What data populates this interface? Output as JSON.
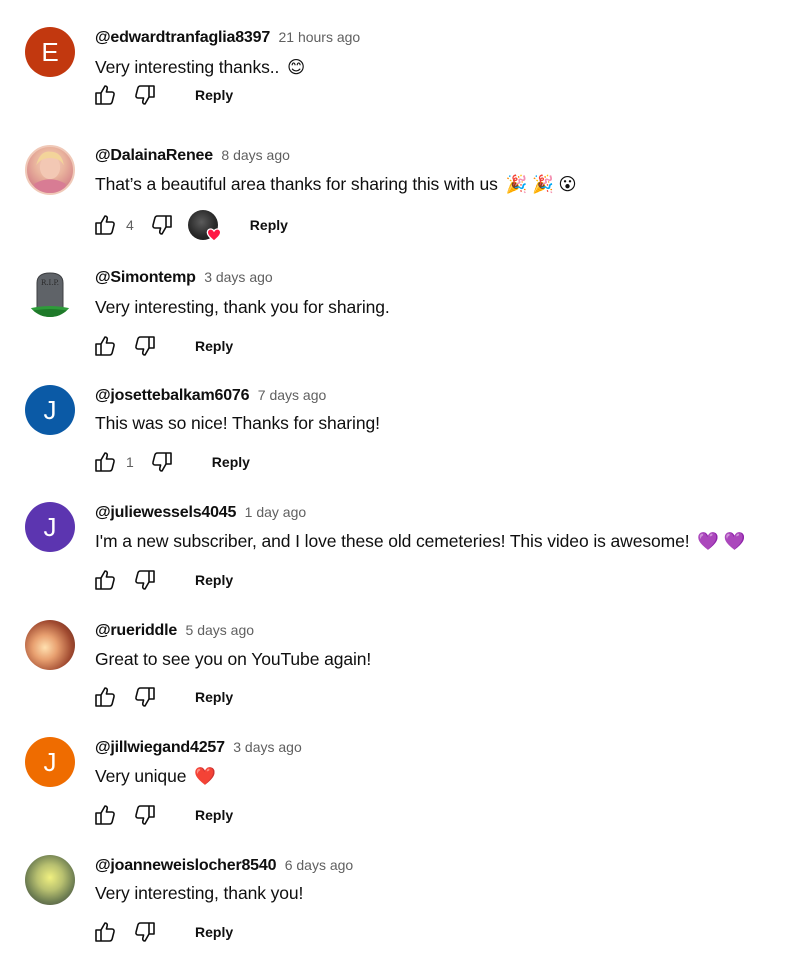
{
  "comments": [
    {
      "avatar_letter": "E",
      "avatar_color": "#c2380f",
      "handle": "@edwardtranfaglia8397",
      "time": "21 hours ago",
      "text": "Very interesting thanks..",
      "emoji": "😊",
      "likes": "",
      "reply": "Reply",
      "creator_heart": false
    },
    {
      "avatar_letter": "",
      "avatar_color": "#e8b4a8",
      "handle": "@DalainaRenee",
      "time": "8 days ago",
      "text": "That’s a beautiful area thanks for sharing this with us",
      "emoji": "🎉 🎉 😮",
      "likes": "4",
      "reply": "Reply",
      "creator_heart": true
    },
    {
      "avatar_letter": "",
      "avatar_color": "#ffffff",
      "handle": "@Simontemp",
      "time": "3 days ago",
      "text": "Very interesting, thank you for sharing.",
      "emoji": "",
      "likes": "",
      "reply": "Reply",
      "creator_heart": false,
      "avatar_tombstone": "R.I.P."
    },
    {
      "avatar_letter": "J",
      "avatar_color": "#0b5aa6",
      "handle": "@josettebalkam6076",
      "time": "7 days ago",
      "text": "This was so nice! Thanks for sharing!",
      "emoji": "",
      "likes": "1",
      "reply": "Reply",
      "creator_heart": false
    },
    {
      "avatar_letter": "J",
      "avatar_color": "#5c35b0",
      "handle": "@juliewessels4045",
      "time": "1 day ago",
      "text": "I'm a new subscriber, and I love these old cemeteries! This video is awesome!",
      "emoji": "💜 💜",
      "likes": "",
      "reply": "Reply",
      "creator_heart": false
    },
    {
      "avatar_letter": "",
      "avatar_color": "#8a3a26",
      "handle": "@rueriddle",
      "time": "5 days ago",
      "text": "Great to see you on YouTube again!",
      "emoji": "",
      "likes": "",
      "reply": "Reply",
      "creator_heart": false
    },
    {
      "avatar_letter": "J",
      "avatar_color": "#ef6c00",
      "handle": "@jillwiegand4257",
      "time": "3 days ago",
      "text": "Very unique",
      "emoji": "❤️",
      "likes": "",
      "reply": "Reply",
      "creator_heart": false
    },
    {
      "avatar_letter": "",
      "avatar_color": "#6f7f52",
      "handle": "@joanneweislocher8540",
      "time": "6 days ago",
      "text": "Very interesting, thank you!",
      "emoji": "",
      "likes": "",
      "reply": "Reply",
      "creator_heart": false
    }
  ]
}
